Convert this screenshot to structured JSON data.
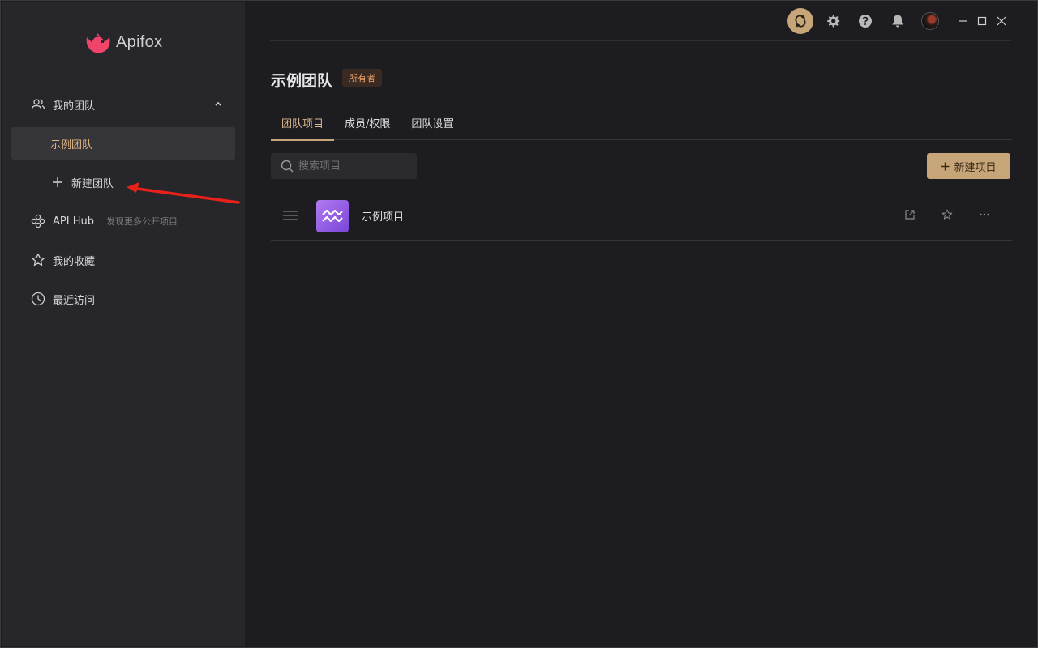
{
  "app": {
    "name": "Apifox"
  },
  "sidebar": {
    "my_teams": "我的团队",
    "active_team": "示例团队",
    "new_team": "新建团队",
    "api_hub": {
      "label": "API Hub",
      "sub": "发现更多公开项目"
    },
    "favorites": "我的收藏",
    "recent": "最近访问"
  },
  "topbar": {
    "icons": [
      "sync-icon",
      "gear-icon",
      "help-icon",
      "bell-icon",
      "avatar",
      "minimize-icon",
      "maximize-icon",
      "close-icon"
    ],
    "accent": "#c6a578"
  },
  "main": {
    "team_name": "示例团队",
    "role_badge": "所有者",
    "tabs": [
      {
        "label": "团队项目",
        "active": true
      },
      {
        "label": "成员/权限",
        "active": false
      },
      {
        "label": "团队设置",
        "active": false
      }
    ],
    "search": {
      "placeholder": "搜索项目"
    },
    "new_project": "新建项目",
    "projects": [
      {
        "name": "示例项目"
      }
    ]
  },
  "annotation": {
    "arrow_color": "#e8221b"
  }
}
